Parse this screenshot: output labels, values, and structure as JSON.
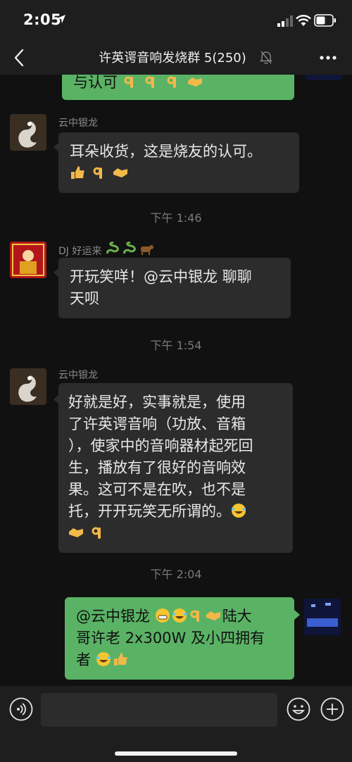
{
  "status": {
    "time": "2:05"
  },
  "header": {
    "title": "许英谔音响发烧群 5(250)"
  },
  "messages": [
    {
      "kind": "outgoing",
      "text": "与认可"
    },
    {
      "kind": "incoming",
      "sender": "云中银龙",
      "text": "耳朵收货，这是烧友的认可。"
    },
    {
      "kind": "time",
      "text": "下午 1:46"
    },
    {
      "kind": "incoming",
      "sender": "DJ 好运来",
      "line1": "开玩笑咩！@云中银龙 聊聊",
      "line2": "天呗"
    },
    {
      "kind": "time",
      "text": "下午 1:54"
    },
    {
      "kind": "incoming",
      "sender": "云中银龙",
      "lines": [
        "好就是好，实事就是，使用",
        "了许英谔音响（功放、音箱",
        "），使家中的音响器材起死回",
        "生，播放有了很好的音响效",
        "果。这可不是在吹，也不是",
        "托，开开玩笑无所谓的。"
      ]
    },
    {
      "kind": "time",
      "text": "下午 2:04"
    },
    {
      "kind": "outgoing",
      "line1": "@云中银龙",
      "line1b": "陆大",
      "line2": "哥许老 2x300W 及小四拥有",
      "line3": "者"
    }
  ],
  "input": {
    "placeholder": ""
  },
  "colors": {
    "bg": "#111111",
    "bar": "#1e1e1e",
    "bubble_in": "#2c2c2c",
    "bubble_out": "#5ab265"
  },
  "icons": [
    "back-chevron-icon",
    "mute-bell-icon",
    "more-dots-icon",
    "voice-icon",
    "emoji-icon",
    "plus-icon",
    "thumbs-up-icon",
    "ok-hand-icon",
    "handshake-icon",
    "grin-icon",
    "laugh-cry-icon",
    "snake-icon",
    "ox-icon"
  ]
}
